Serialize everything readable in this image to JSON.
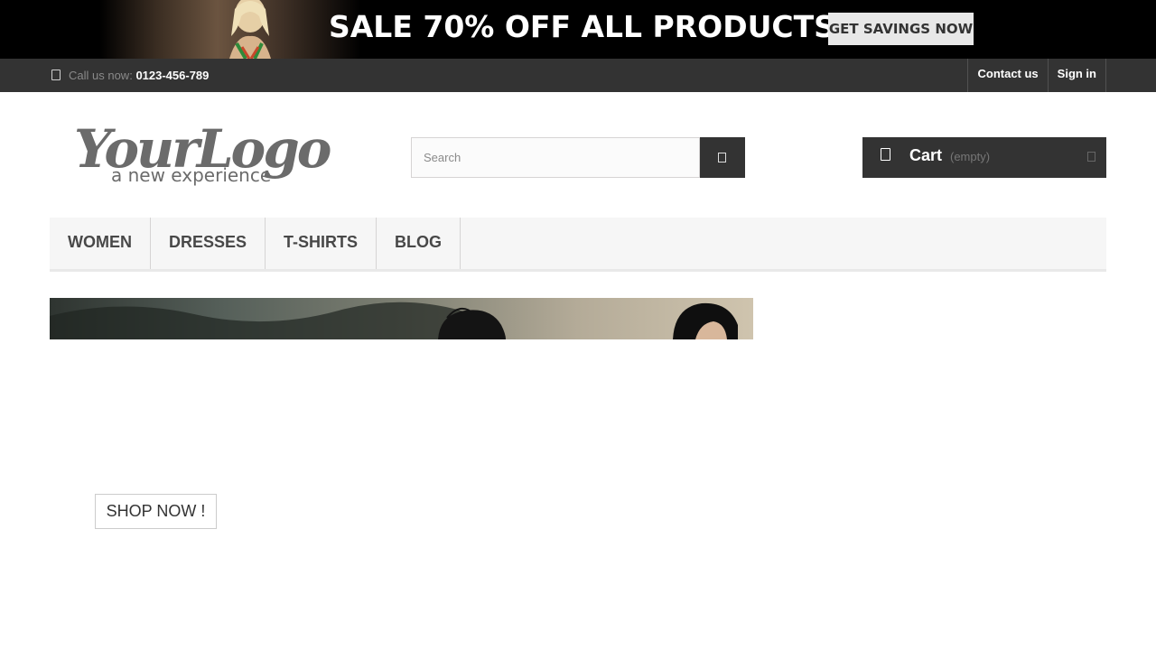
{
  "promo": {
    "headline": "SALE 70% OFF ALL PRODUCTS",
    "cta_label": "GET SAVINGS NOW"
  },
  "topbar": {
    "phone_prefix": "Call us now:",
    "phone_number": "0123-456-789",
    "phone_icon": "phone-icon",
    "contact_label": "Contact us",
    "signin_label": "Sign in"
  },
  "header": {
    "logo_main": "YourLogo",
    "logo_tagline": "a new experience",
    "search_placeholder": "Search",
    "search_icon": "search-icon",
    "cart_label": "Cart",
    "cart_status": "(empty)",
    "cart_icon": "shopping-cart-icon"
  },
  "menu": {
    "items": [
      "WOMEN",
      "DRESSES",
      "T-SHIRTS",
      "BLOG"
    ]
  },
  "slider": {
    "cta_label": "SHOP NOW !"
  },
  "colors": {
    "topbar_bg": "#333333",
    "promo_bg": "#000000",
    "cart_bg": "#333333",
    "menu_bg": "#f6f6f6"
  }
}
